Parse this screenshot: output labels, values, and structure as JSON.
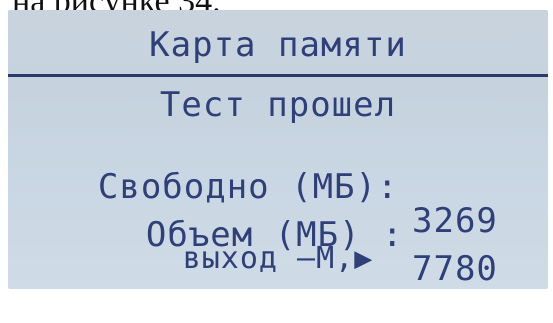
{
  "page_caption": "на рисунке 34.",
  "screen": {
    "title": "Карта памяти",
    "status": "Тест прошел",
    "free_label": "Свободно (МБ):",
    "free_value": "3269",
    "volume_label": "Объем (МБ) :",
    "volume_value": "7780",
    "exit_hint": "выход –М,▶"
  },
  "colors": {
    "lcd_background": "#c9d6e3",
    "lcd_text": "#2f3f78"
  }
}
